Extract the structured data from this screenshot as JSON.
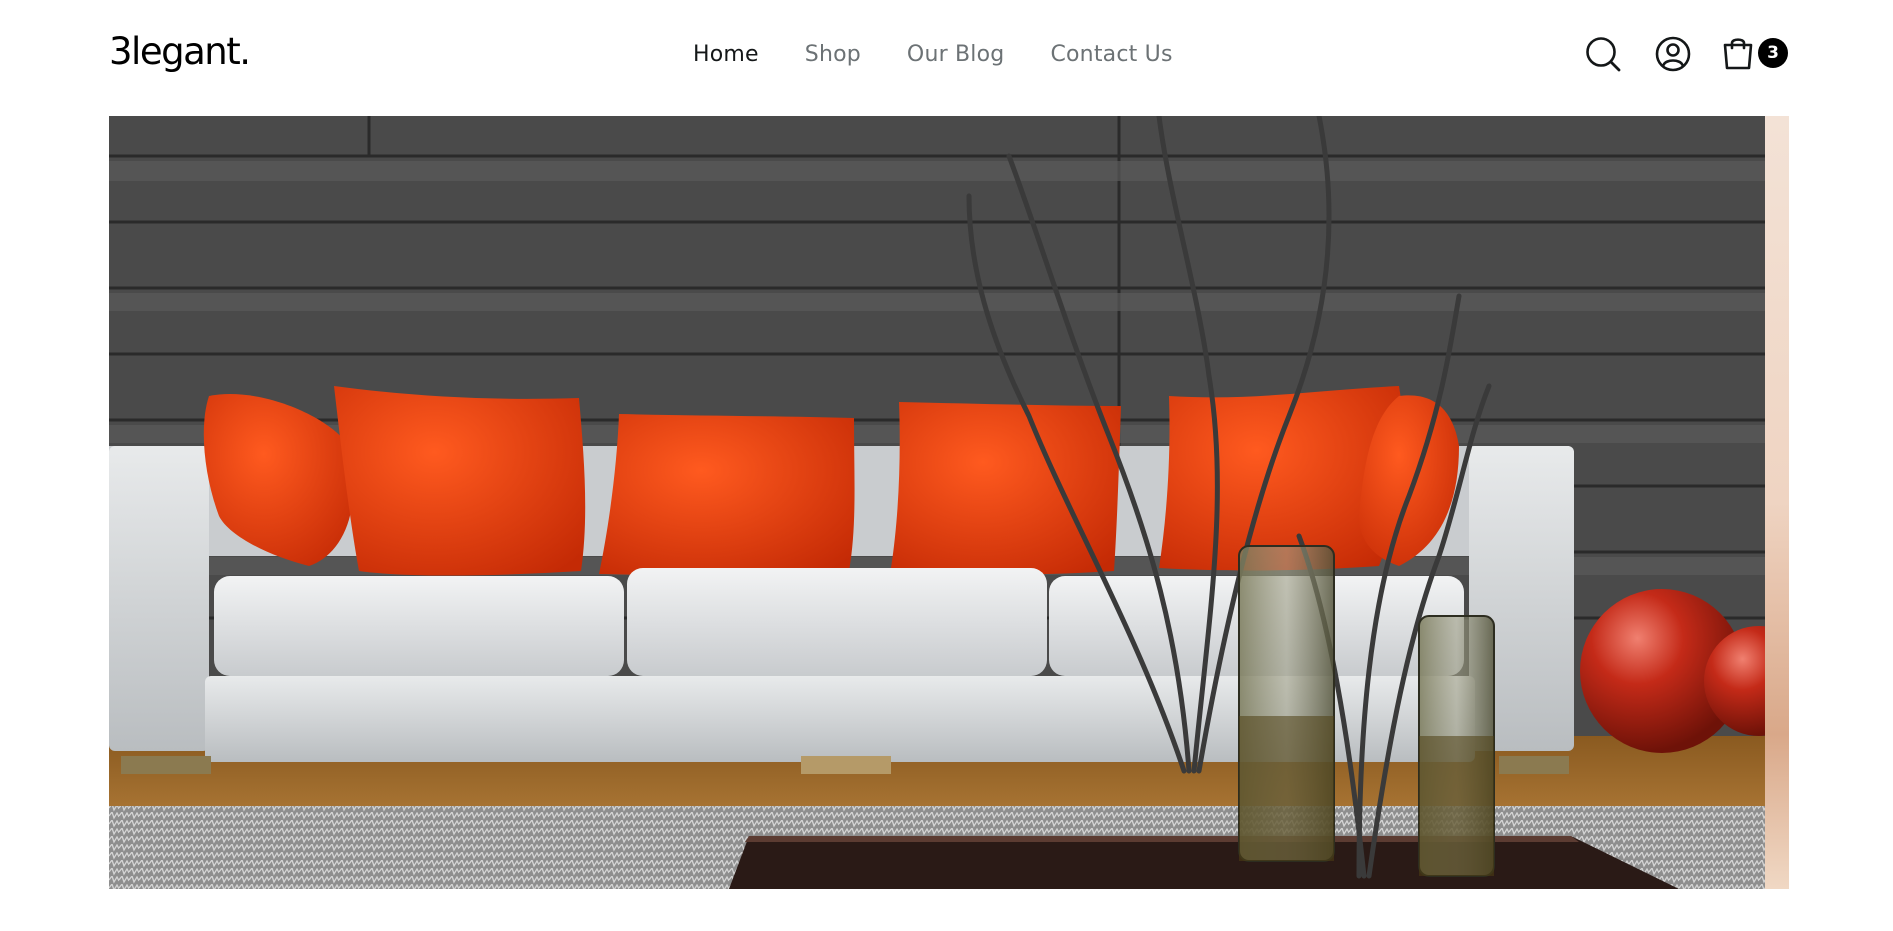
{
  "brand": {
    "logo_text": "3legant."
  },
  "nav": {
    "items": [
      {
        "label": "Home",
        "active": true
      },
      {
        "label": "Shop",
        "active": false
      },
      {
        "label": "Our Blog",
        "active": false
      },
      {
        "label": "Contact Us",
        "active": false
      }
    ]
  },
  "header_icons": {
    "search": "search-icon",
    "account": "user-icon",
    "cart": "shopping-bag-icon",
    "cart_count": "3"
  },
  "hero": {
    "slide_description_icon": "living-room-sofa-image",
    "colors": {
      "wall": "#4b4b4b",
      "pillow": "#e63a0e",
      "sofa": "#d9dcdd",
      "floor": "#b07a35",
      "rug": "#9a9a9a"
    }
  }
}
